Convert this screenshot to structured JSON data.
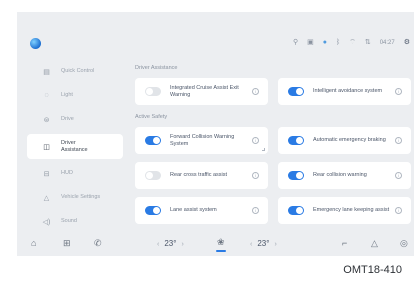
{
  "status_bar": {
    "icons": [
      "person-icon",
      "display-icon",
      "wifi-icon",
      "bluetooth-icon",
      "signal-icon",
      "network-icon",
      "settings-icon"
    ],
    "time": "04:27"
  },
  "sidebar": {
    "items": [
      {
        "label": "Quick Control",
        "icon": "quick-control-icon"
      },
      {
        "label": "Light",
        "icon": "light-icon"
      },
      {
        "label": "Drive",
        "icon": "steering-wheel-icon"
      },
      {
        "label": "Driver\nAssistance",
        "icon": "driver-assistance-icon",
        "active": true
      },
      {
        "label": "HUD",
        "icon": "hud-icon"
      },
      {
        "label": "Vehicle Settings",
        "icon": "car-icon"
      },
      {
        "label": "Sound",
        "icon": "sound-icon"
      }
    ]
  },
  "main": {
    "section1_title": "Driver Assistance",
    "section2_title": "Active Safety",
    "cards1": [
      {
        "label": "Integrated Cruise Assist Exit Warning",
        "on": false
      },
      {
        "label": "Intelligent avoidance system",
        "on": true
      }
    ],
    "cards2": [
      {
        "label": "Forward Collision Warning System",
        "on": true
      },
      {
        "label": "Automatic emergency braking",
        "on": true
      },
      {
        "label": "Rear cross traffic assist",
        "on": false
      },
      {
        "label": "Rear collision warning",
        "on": true
      },
      {
        "label": "Lane assist system",
        "on": true
      },
      {
        "label": "Emergency lane keeping assist",
        "on": true
      }
    ]
  },
  "bottom_bar": {
    "left_temp": "23°",
    "right_temp": "23°",
    "icons": [
      "home-icon",
      "apps-icon",
      "phone-icon",
      "fan-icon",
      "seat-icon",
      "navigation-icon",
      "steering-heat-icon"
    ]
  },
  "caption": "OMT18-410"
}
